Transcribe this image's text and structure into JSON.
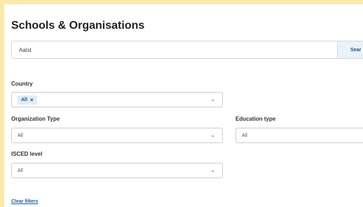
{
  "header": {
    "title": "Schools & Organisations"
  },
  "search": {
    "value": "Aalst",
    "button_label": "Sear"
  },
  "filters": {
    "country": {
      "label": "Country",
      "chip": "All",
      "chip_remove": "×"
    },
    "organization_type": {
      "label": "Organization Type",
      "value": "All"
    },
    "education_type": {
      "label": "Education type",
      "value": "All"
    },
    "isced_level": {
      "label": "ISCED level",
      "value": "All"
    },
    "clear_label": "Clear filters"
  },
  "icons": {
    "chevron": "⌄"
  },
  "colors": {
    "background": "#fce9a8",
    "link": "#1a5fa8",
    "chip_bg": "#e1edf6"
  }
}
